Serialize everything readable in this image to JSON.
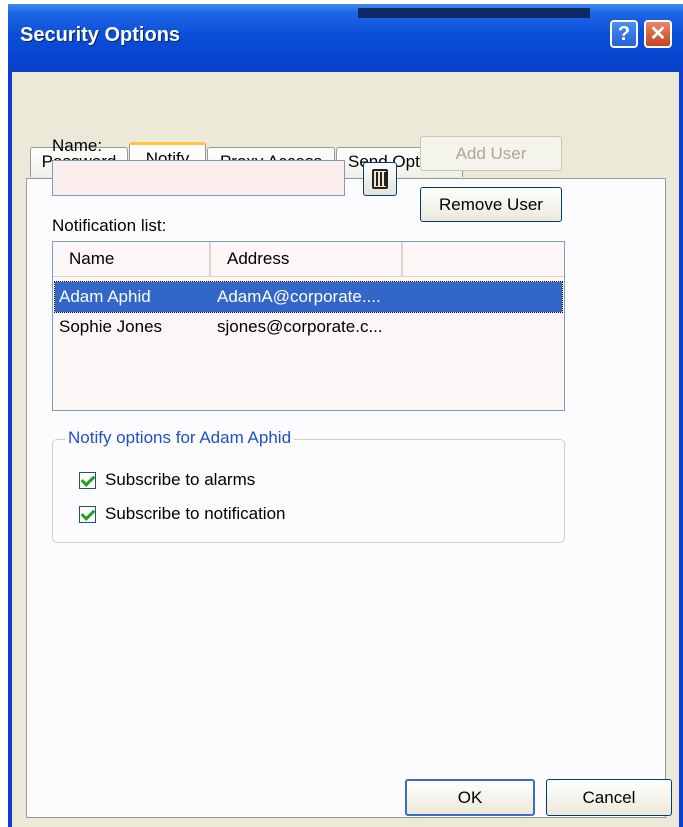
{
  "window": {
    "title": "Security Options",
    "help_glyph": "?",
    "close_glyph": "✕"
  },
  "tabs": [
    {
      "label": "Password",
      "active": false
    },
    {
      "label": "Notify",
      "active": true
    },
    {
      "label": "Proxy Access",
      "active": false
    },
    {
      "label": "Send Options",
      "active": false
    }
  ],
  "notify": {
    "name_label": "Name:",
    "name_value": "",
    "address_book_icon": "address-book-icon",
    "add_user_label": "Add User",
    "add_user_enabled": false,
    "remove_user_label": "Remove User",
    "list_label": "Notification list:",
    "columns": [
      "Name",
      "Address"
    ],
    "rows": [
      {
        "name": "Adam Aphid",
        "address": "AdamA@corporate....",
        "selected": true
      },
      {
        "name": "Sophie Jones",
        "address": "sjones@corporate.c...",
        "selected": false
      }
    ],
    "options_group_label": "Notify options for Adam Aphid",
    "options": [
      {
        "label": "Subscribe to alarms",
        "checked": true
      },
      {
        "label": "Subscribe to notification",
        "checked": true
      }
    ]
  },
  "footer": {
    "ok_label": "OK",
    "cancel_label": "Cancel"
  },
  "colors": {
    "title_bar": "#0a4fd9",
    "selection": "#3266c8",
    "group_label": "#2050c8",
    "dialog_face": "#ece9d8"
  }
}
